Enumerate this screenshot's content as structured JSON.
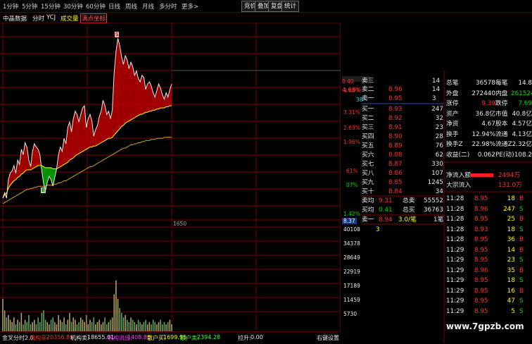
{
  "toolbar": {
    "periods": [
      "1分钟",
      "5分钟",
      "15分钟",
      "30分钟",
      "60分钟",
      "日线",
      "周线",
      "月线",
      "多分时",
      "更多>"
    ],
    "buttons": [
      "竞价",
      "叠加",
      "复盘",
      "统计"
    ]
  },
  "subbar": {
    "source": "中晶数据",
    "mode": "分时",
    "indicator": "YCJ",
    "volume_label": "成交量",
    "coord_label": "满点坐标"
  },
  "chart_data": {
    "type": "line",
    "price_axis_labels": [
      "4.68%",
      "3.31%",
      "2.63%",
      "1.96%",
      "61%",
      "07%",
      "1.42%"
    ],
    "volume_axis_labels": [
      "40108",
      "34378",
      "28649",
      "22919",
      "17189",
      "11459",
      "5730"
    ],
    "current_price_tag": "8.37",
    "time_marker": "1650",
    "price_y_range": [
      7.85,
      9.6
    ],
    "volume_y_range": [
      0,
      45000
    ],
    "price": [
      8.05,
      8.1,
      8.05,
      8.22,
      8.28,
      8.3,
      8.35,
      8.28,
      8.4,
      8.36,
      8.5,
      8.45,
      8.56,
      8.52,
      8.4,
      8.34,
      8.48,
      8.55,
      8.52,
      8.5,
      8.45,
      8.3,
      8.18,
      8.12,
      8.2,
      8.25,
      8.22,
      8.16,
      8.24,
      8.32,
      8.45,
      8.52,
      8.48,
      8.6,
      8.55,
      8.7,
      8.75,
      8.66,
      8.78,
      8.85,
      8.82,
      8.75,
      8.82,
      8.88,
      8.9,
      8.7,
      8.78,
      8.82,
      8.76,
      8.62,
      8.68,
      8.72,
      8.8,
      8.85,
      8.95,
      8.9,
      8.82,
      8.85,
      8.78,
      8.86,
      9.2,
      9.4,
      9.52,
      9.45,
      9.35,
      9.28,
      9.36,
      9.32,
      9.24,
      9.3,
      9.26,
      9.18,
      9.22,
      9.15,
      9.12,
      9.18,
      9.16,
      9.05,
      9.1,
      9.12,
      9.08,
      9.02,
      8.98,
      9.04,
      9.1,
      9.06,
      9.0,
      8.96,
      9.02,
      8.98,
      9.05,
      9.1
    ],
    "avg_price": [
      8.05,
      8.08,
      8.1,
      8.14,
      8.17,
      8.19,
      8.21,
      8.22,
      8.24,
      8.25,
      8.27,
      8.28,
      8.3,
      8.31,
      8.31,
      8.31,
      8.32,
      8.33,
      8.34,
      8.35,
      8.35,
      8.35,
      8.34,
      8.33,
      8.33,
      8.33,
      8.33,
      8.32,
      8.32,
      8.32,
      8.33,
      8.34,
      8.35,
      8.36,
      8.37,
      8.38,
      8.4,
      8.41,
      8.42,
      8.44,
      8.45,
      8.46,
      8.47,
      8.48,
      8.49,
      8.5,
      8.51,
      8.52,
      8.52,
      8.53,
      8.53,
      8.54,
      8.55,
      8.56,
      8.57,
      8.58,
      8.59,
      8.6,
      8.6,
      8.61,
      8.63,
      8.65,
      8.67,
      8.69,
      8.71,
      8.72,
      8.74,
      8.75,
      8.76,
      8.77,
      8.78,
      8.79,
      8.8,
      8.81,
      8.82,
      8.82,
      8.83,
      8.84,
      8.84,
      8.85,
      8.85,
      8.86,
      8.86,
      8.87,
      8.87,
      8.88,
      8.88,
      8.88,
      8.89,
      8.89,
      8.9,
      8.9
    ],
    "slow_avg": [
      8.0,
      8.01,
      8.02,
      8.03,
      8.04,
      8.05,
      8.06,
      8.07,
      8.08,
      8.09,
      8.1,
      8.11,
      8.12,
      8.13,
      8.13,
      8.14,
      8.14,
      8.15,
      8.15,
      8.16,
      8.16,
      8.16,
      8.16,
      8.16,
      8.17,
      8.17,
      8.17,
      8.17,
      8.18,
      8.18,
      8.19,
      8.19,
      8.2,
      8.21,
      8.21,
      8.22,
      8.23,
      8.24,
      8.25,
      8.26,
      8.27,
      8.28,
      8.29,
      8.3,
      8.31,
      8.32,
      8.33,
      8.34,
      8.34,
      8.35,
      8.36,
      8.37,
      8.38,
      8.39,
      8.4,
      8.41,
      8.42,
      8.43,
      8.44,
      8.45,
      8.46,
      8.47,
      8.48,
      8.49,
      8.5,
      8.51,
      8.51,
      8.52,
      8.53,
      8.54,
      8.54,
      8.55,
      8.55,
      8.56,
      8.56,
      8.57,
      8.57,
      8.58,
      8.58,
      8.58,
      8.59,
      8.59,
      8.59,
      8.6,
      8.6,
      8.6,
      8.6,
      8.61,
      8.61,
      8.61,
      8.61,
      8.61
    ],
    "volume": [
      14000,
      9000,
      6000,
      7000,
      5000,
      4000,
      6000,
      3000,
      5000,
      4000,
      8000,
      3000,
      5000,
      4000,
      7000,
      3000,
      4000,
      5000,
      3000,
      6000,
      4000,
      8000,
      9000,
      5000,
      4000,
      3000,
      5000,
      6000,
      4000,
      3000,
      7000,
      5000,
      4000,
      6000,
      3000,
      5000,
      8000,
      4000,
      6000,
      5000,
      3000,
      4000,
      6000,
      5000,
      4000,
      7000,
      3000,
      5000,
      4000,
      6000,
      3000,
      4000,
      5000,
      3000,
      4000,
      6000,
      3000,
      4000,
      5000,
      6000,
      16000,
      22000,
      14000,
      10000,
      8000,
      6000,
      7000,
      5000,
      4000,
      6000,
      5000,
      4000,
      3000,
      5000,
      4000,
      3000,
      4000,
      5000,
      3000,
      4000,
      3000,
      5000,
      4000,
      3000,
      4000,
      5000,
      3000,
      4000,
      3000,
      4000,
      5000,
      3000
    ]
  },
  "buy_signal": "B",
  "sell_signal": "S",
  "quote": {
    "top_partial": [
      "0.40",
      "14"
    ],
    "sell_orders": [
      {
        "label": "卖二",
        "price": "8.96",
        "pct": "4.68%",
        "vol": "14"
      },
      {
        "label": "卖一",
        "price": "8.95",
        "pct": "",
        "vol": "3"
      }
    ],
    "mid_label": "38",
    "buy_orders": [
      {
        "label": "买一",
        "price": "8.93",
        "vol": "247"
      },
      {
        "label": "买二",
        "price": "8.92",
        "vol": "32"
      },
      {
        "label": "买三",
        "price": "8.91",
        "vol": "23"
      },
      {
        "label": "买四",
        "price": "8.90",
        "vol": "28"
      },
      {
        "label": "买五",
        "price": "8.89",
        "vol": "76"
      },
      {
        "label": "买六",
        "price": "8.88",
        "vol": "62"
      },
      {
        "label": "买七",
        "price": "8.87",
        "vol": "330"
      },
      {
        "label": "买八",
        "price": "8.86",
        "vol": "107"
      },
      {
        "label": "买九",
        "price": "8.85",
        "vol": "1245"
      },
      {
        "label": "买十",
        "price": "8.84",
        "vol": "34"
      }
    ],
    "avg_sell": {
      "label": "卖均",
      "price": "9.31",
      "tot_label": "总卖",
      "tot": "55552"
    },
    "avg_buy": {
      "label": "买均",
      "price": "0.41",
      "tot_label": "总买",
      "tot": "36763"
    },
    "bottom": {
      "label": "卖一",
      "price": "8.94",
      "ratio": "3.0/笔",
      "count": "1笔",
      "extra": "3"
    }
  },
  "stats": [
    {
      "k1": "总笔",
      "v1": "36578",
      "k2": "每笔",
      "v2": "14.8"
    },
    {
      "k1": "外盘",
      "v1": "272440",
      "k2": "内盘",
      "v2": "261524"
    },
    {
      "k1": "涨停",
      "v1": "9.39",
      "k2": "跌停",
      "v2": "7.69"
    },
    {
      "k1": "资产",
      "v1": "36.8亿",
      "k2": "市值",
      "v2": "40.8亿"
    },
    {
      "k1": "净资",
      "v1": "4.67",
      "k2": "股本",
      "v2": "4.57亿"
    },
    {
      "k1": "换手",
      "v1": "12.94%",
      "k2": "流通",
      "v2": "4.13亿"
    },
    {
      "k1": "换手Z",
      "v1": "22.98%",
      "k2": "流通Z",
      "v2": "2.32亿"
    },
    {
      "k1": "收益(二)",
      "v1": "0.062",
      "k2": "PE(动)",
      "v2": "108.2"
    }
  ],
  "flow": [
    {
      "label": "净流入额",
      "value": "2494万"
    },
    {
      "label": "大宗流入",
      "value": "131.0万"
    }
  ],
  "ticks": [
    {
      "t": "11:28",
      "p": "8.95",
      "v": "18",
      "bs": "B"
    },
    {
      "t": "11:28",
      "p": "8.96",
      "v": "247",
      "bs": "S"
    },
    {
      "t": "11:28",
      "p": "8.95",
      "v": "25",
      "bs": "B"
    },
    {
      "t": "11:28",
      "p": "8.93",
      "v": "18",
      "bs": "S"
    },
    {
      "t": "11:28",
      "p": "8.95",
      "v": "36",
      "bs": "B"
    },
    {
      "t": "11:29",
      "p": "8.95",
      "v": "14",
      "bs": "B"
    },
    {
      "t": "11:29",
      "p": "8.95",
      "v": "23",
      "bs": "S"
    },
    {
      "t": "11:29",
      "p": "8.96",
      "v": "35",
      "bs": "B"
    },
    {
      "t": "11:29",
      "p": "8.95",
      "v": "18",
      "bs": "S"
    },
    {
      "t": "11:29",
      "p": "8.95",
      "v": "16",
      "bs": "B"
    },
    {
      "t": "11:29",
      "p": "8.95",
      "v": "47",
      "bs": "S"
    },
    {
      "t": "11:29",
      "p": "8.95",
      "v": "5",
      "bs": "S"
    }
  ],
  "watermark": "www.7gpzb.com",
  "bottombar": {
    "name": "金叉分时2.0",
    "items": [
      {
        "label": "机构买:",
        "value": "20356.86"
      },
      {
        "label": "机构卖:",
        "value": "18655.01"
      },
      {
        "label": "机构流出:",
        "value": "1408.86"
      },
      {
        "label": "散户买:",
        "value": "1699.95"
      },
      {
        "label": "散户卖:",
        "value": "2394.28"
      },
      {
        "label": "拉升:",
        "value": "0.00"
      }
    ],
    "settings": "右键设置"
  },
  "colors": {
    "up": "#ff3232",
    "down": "#00e000",
    "grid": "#7a0000",
    "price_line": "#e8e8e8",
    "avg_line": "#ffff00",
    "slow_line": "#d0a020"
  }
}
